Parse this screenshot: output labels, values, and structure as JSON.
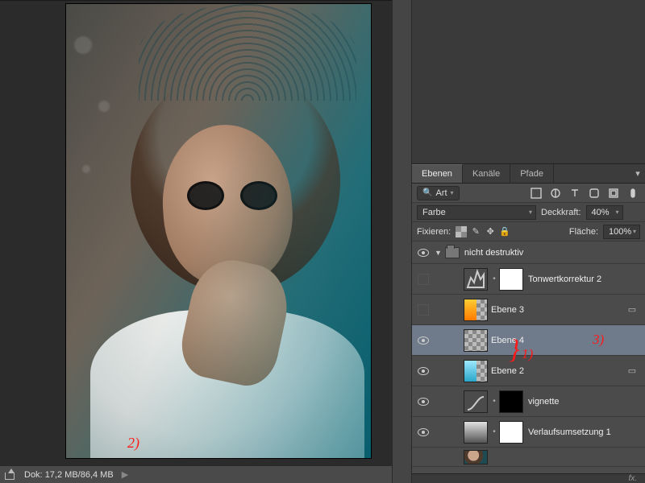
{
  "status": {
    "doc_label": "Dok:",
    "doc_size": "17,2 MB/86,4 MB"
  },
  "panel_tabs": {
    "layers": "Ebenen",
    "channels": "Kanäle",
    "paths": "Pfade"
  },
  "filter_row": {
    "search_label": "Art"
  },
  "blend_row": {
    "mode": "Farbe",
    "opacity_label": "Deckkraft:",
    "opacity_value": "40%"
  },
  "lock_row": {
    "fix_label": "Fixieren:",
    "fill_label": "Fläche:",
    "fill_value": "100%"
  },
  "layers": {
    "group": "nicht destruktiv",
    "levels": "Tonwertkorrektur 2",
    "l3": "Ebene 3",
    "l4": "Ebene 4",
    "l2": "Ebene 2",
    "vignette": "vignette",
    "gradmap": "Verlaufsumsetzung 1"
  },
  "annotations": {
    "a1": "1)",
    "a2": "2)",
    "a3": "3)"
  },
  "fx": "fx."
}
